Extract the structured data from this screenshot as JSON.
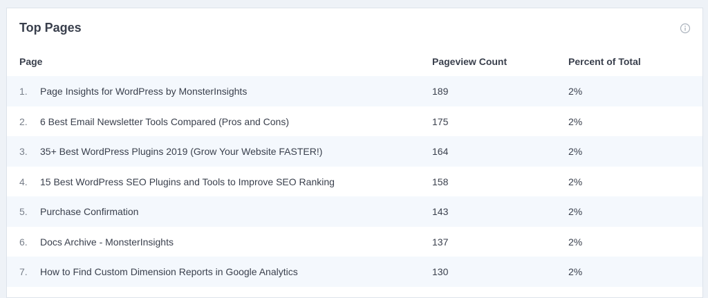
{
  "widget": {
    "title": "Top Pages",
    "info_icon": "info-circle-icon"
  },
  "table": {
    "columns": [
      "Page",
      "Pageview Count",
      "Percent of Total"
    ],
    "rows": [
      {
        "num": "1.",
        "page": "Page Insights for WordPress by MonsterInsights",
        "count": "189",
        "percent": "2%"
      },
      {
        "num": "2.",
        "page": "6 Best Email Newsletter Tools Compared (Pros and Cons)",
        "count": "175",
        "percent": "2%"
      },
      {
        "num": "3.",
        "page": "35+ Best WordPress Plugins 2019 (Grow Your Website FASTER!)",
        "count": "164",
        "percent": "2%"
      },
      {
        "num": "4.",
        "page": "15 Best WordPress SEO Plugins and Tools to Improve SEO Ranking",
        "count": "158",
        "percent": "2%"
      },
      {
        "num": "5.",
        "page": "Purchase Confirmation",
        "count": "143",
        "percent": "2%"
      },
      {
        "num": "6.",
        "page": "Docs Archive - MonsterInsights",
        "count": "137",
        "percent": "2%"
      },
      {
        "num": "7.",
        "page": "How to Find Custom Dimension Reports in Google Analytics",
        "count": "130",
        "percent": "2%"
      }
    ]
  },
  "colors": {
    "row_alt": "#f4f8fd",
    "text": "#393f4c",
    "muted": "#777e89"
  }
}
